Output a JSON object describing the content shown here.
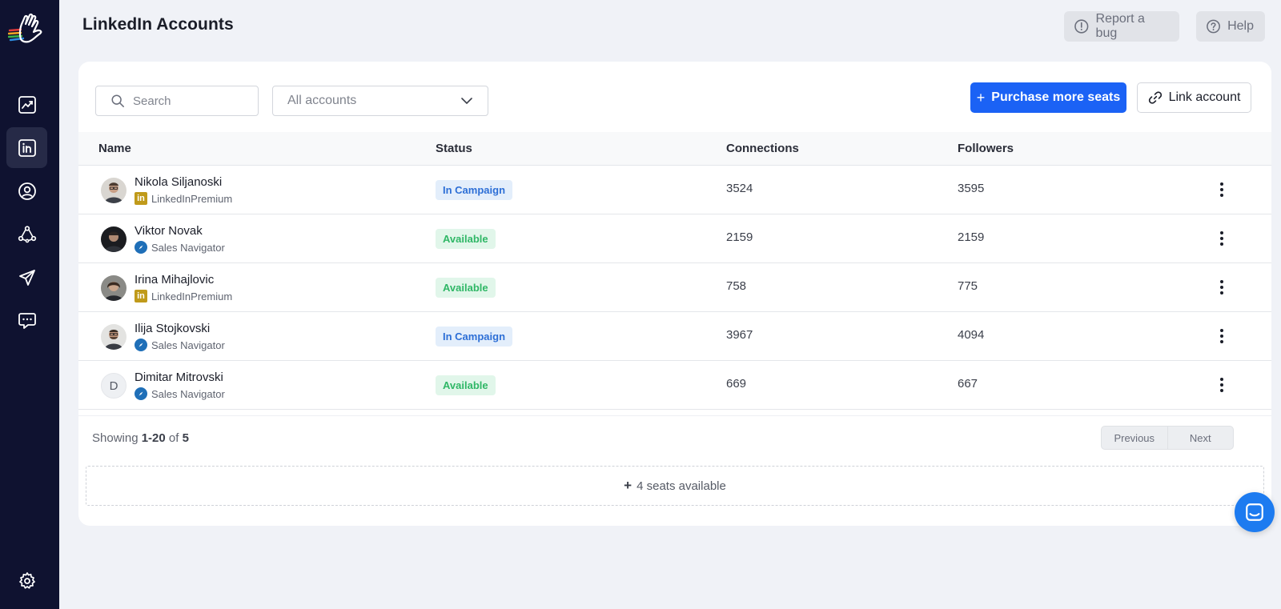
{
  "header": {
    "title": "LinkedIn Accounts",
    "report_bug_label": "Report a bug",
    "help_label": "Help"
  },
  "sidebar": {
    "items": [
      {
        "icon": "chart-icon",
        "active": false
      },
      {
        "icon": "linkedin-icon",
        "active": true
      },
      {
        "icon": "user-circle-icon",
        "active": false
      },
      {
        "icon": "network-icon",
        "active": false
      },
      {
        "icon": "send-icon",
        "active": false
      },
      {
        "icon": "chat-icon",
        "active": false
      }
    ],
    "bottom_icon": "gear-icon"
  },
  "toolbar": {
    "search_placeholder": "Search",
    "filter_value": "All accounts",
    "purchase_label": "Purchase more seats",
    "link_label": "Link account"
  },
  "table": {
    "columns": [
      "Name",
      "Status",
      "Connections",
      "Followers"
    ],
    "rows": [
      {
        "name": "Nikola Siljanoski",
        "type": "LinkedInPremium",
        "status": "In Campaign",
        "connections": "3524",
        "followers": "3595"
      },
      {
        "name": "Viktor Novak",
        "type": "Sales Navigator",
        "status": "Available",
        "connections": "2159",
        "followers": "2159"
      },
      {
        "name": "Irina Mihajlovic",
        "type": "LinkedInPremium",
        "status": "Available",
        "connections": "758",
        "followers": "775"
      },
      {
        "name": "Ilija Stojkovski",
        "type": "Sales Navigator",
        "status": "In Campaign",
        "connections": "3967",
        "followers": "4094"
      },
      {
        "name": "Dimitar Mitrovski",
        "type": "Sales Navigator",
        "status": "Available",
        "connections": "669",
        "followers": "667",
        "initial": "D"
      }
    ]
  },
  "footer": {
    "showing_prefix": "Showing",
    "range": "1-20",
    "of_label": "of",
    "total": "5",
    "previous_label": "Previous",
    "next_label": "Next",
    "seats_label": "4 seats available"
  },
  "colors": {
    "sidebar_bg": "#0f1230",
    "primary": "#1b62f5",
    "campaign_badge": "#2d6fd6",
    "available_badge": "#2fb766"
  }
}
